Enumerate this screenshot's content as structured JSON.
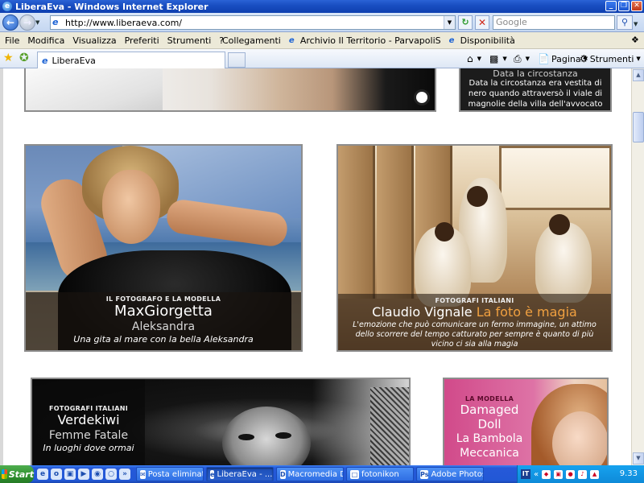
{
  "window": {
    "title": "LiberaEva - Windows Internet Explorer",
    "minimize_icon": "_",
    "restore_icon": "❐",
    "close_icon": "✕"
  },
  "address_bar": {
    "back_icon": "arrow-left",
    "forward_icon": "arrow-right",
    "url": "http://www.liberaeva.com/",
    "search_placeholder": "Google"
  },
  "menu": {
    "items": [
      "File",
      "Modifica",
      "Visualizza",
      "Preferiti",
      "Strumenti",
      "?"
    ],
    "links_label": "Collegamenti",
    "links": [
      "Archivio Il Territorio - ParvapoliS",
      "Disponibilità"
    ]
  },
  "tabs": {
    "active_tab": "LiberaEva"
  },
  "command_bar": {
    "page_label": "Pagina",
    "tools_label": "Strumenti"
  },
  "page": {
    "top_right_card": {
      "title": "Data la circostanza",
      "text": "Data la circostanza era vestita di nero quando attraversò il viale di magnolie della villa dell'avvocato"
    },
    "card_model": {
      "kicker": "IL FOTOGRAFO E LA MODELLA",
      "headline": "MaxGiorgetta",
      "subhead": "Aleksandra",
      "caption": "Una gita al mare con la bella Aleksandra"
    },
    "card_dancers": {
      "kicker": "FOTOGRAFI ITALIANI",
      "headline": "Claudio Vignale",
      "headline_accent": "La foto è magia",
      "caption": "L'emozione che può comunicare un fermo immagine, un attimo dello scorrere del tempo catturato per sempre è quanto di più vicino ci sia alla magia"
    },
    "card_verdekiwi": {
      "kicker": "FOTOGRAFI ITALIANI",
      "headline": "Verdekiwi",
      "subhead": "Femme Fatale",
      "caption": "In luoghi dove ormai"
    },
    "card_doll": {
      "kicker": "LA MODELLA",
      "headline_line1": "Damaged",
      "headline_line2": "Doll",
      "subhead_line1": "La Bambola",
      "subhead_line2": "Meccanica"
    }
  },
  "taskbar": {
    "start_label": "Start",
    "buttons": [
      "Posta eliminat...",
      "LiberaEva - ...",
      "Macromedia D...",
      "fotonikon",
      "Adobe Photos..."
    ],
    "language": "IT",
    "clock": "9.33"
  }
}
